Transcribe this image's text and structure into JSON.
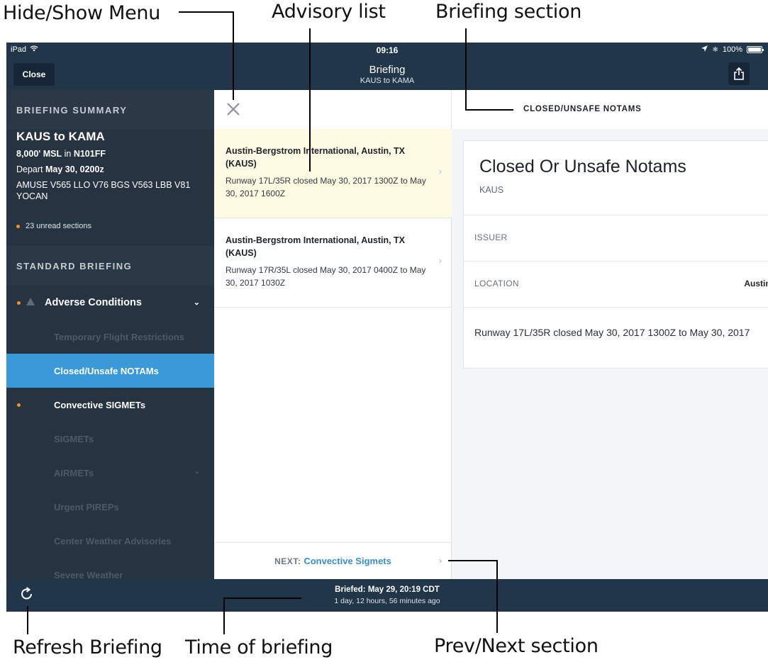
{
  "annotations": {
    "hide_show_menu": "Hide/Show Menu",
    "advisory_list": "Advisory list",
    "briefing_section": "Briefing section",
    "refresh_briefing": "Refresh Briefing",
    "time_of_briefing": "Time of briefing",
    "prev_next_section": "Prev/Next section"
  },
  "status_bar": {
    "device": "iPad",
    "time": "09:16",
    "battery": "100%",
    "wifi_icon": "wifi-icon",
    "location_icon": "location-arrow-icon",
    "bluetooth_icon": "bluetooth-icon"
  },
  "nav_bar": {
    "close_label": "Close",
    "title": "Briefing",
    "subtitle": "KAUS to KAMA",
    "share_icon": "share-icon"
  },
  "sidebar": {
    "summary_header": "BRIEFING SUMMARY",
    "route": "KAUS to KAMA",
    "altitude": "8,000' MSL",
    "in_text": "in",
    "aircraft": "N101FF",
    "depart_label": "Depart",
    "depart_time": "May 30, 0200z",
    "route_string": "AMUSE V565 LLO V76 BGS V563 LBB V81 YOCAN",
    "unread": "23 unread sections",
    "standard_header": "STANDARD BRIEFING",
    "group": "Adverse Conditions",
    "items": [
      {
        "label": "Temporary Flight Restrictions"
      },
      {
        "label": "Closed/Unsafe NOTAMs"
      },
      {
        "label": "Convective SIGMETs"
      },
      {
        "label": "SIGMETs"
      },
      {
        "label": "AIRMETs"
      },
      {
        "label": "Urgent PIREPs"
      },
      {
        "label": "Center Weather Advisories"
      },
      {
        "label": "Severe Weather"
      }
    ],
    "accent_color": "#3a99d8",
    "unread_dot_color": "#f0912c"
  },
  "advisories": [
    {
      "title": "Austin-Bergstrom International, Austin, TX (KAUS)",
      "detail": "Runway 17L/35R closed May 30, 2017 1300Z to May 30, 2017 1600Z"
    },
    {
      "title": "Austin-Bergstrom International, Austin, TX (KAUS)",
      "detail": "Runway 17R/35L closed May 30, 2017 0400Z to May 30, 2017 1030Z"
    }
  ],
  "next": {
    "label": "NEXT:",
    "value": "Convective Sigmets"
  },
  "detail": {
    "section_title": "CLOSED/UNSAFE NOTAMS",
    "heading": "Closed Or Unsafe Notams",
    "airport": "KAUS",
    "issuer_label": "ISSUER",
    "location_label": "LOCATION",
    "location_value": "Austin-I",
    "body": "Runway 17L/35R closed May 30, 2017 1300Z to May 30, 2017"
  },
  "bottom_bar": {
    "briefed": "Briefed: May 29, 20:19 CDT",
    "ago": "1 day, 12 hours, 56 minutes ago",
    "refresh_icon": "refresh-icon"
  }
}
